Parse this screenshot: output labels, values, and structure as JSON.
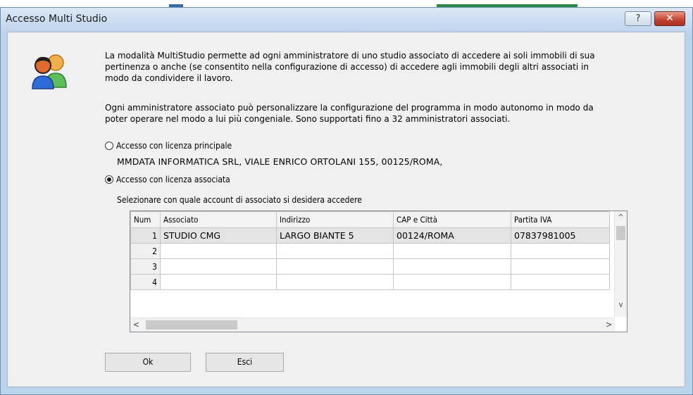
{
  "window": {
    "title": "Accesso Multi Studio",
    "help_button": "?",
    "close_button": "✕"
  },
  "icon": "users-icon",
  "description": {
    "paragraph1": "La modalità MultiStudio permette ad ogni amministratore di uno studio associato di accedere ai soli immobili di sua pertinenza o anche (se consentito nella configurazione di accesso) di accedere agli immobili degli altri associati in modo da condividere il lavoro.",
    "paragraph2": "Ogni amministratore associato può personalizzare la configurazione del programma in modo autonomo in modo da poter operare nel modo a lui più congeniale. Sono supportati fino a 32 amministratori associati."
  },
  "options": {
    "principal_label": "Accesso con licenza principale",
    "principal_checked": false,
    "principal_info": "MMDATA INFORMATICA SRL, VIALE ENRICO ORTOLANI 155, 00125/ROMA,",
    "associated_label": "Accesso con licenza associata",
    "associated_checked": true
  },
  "select_label": "Selezionare con quale account di associato si desidera accedere",
  "table": {
    "columns": [
      "Num",
      "Associato",
      "Indirizzo",
      "CAP e Città",
      "Partita IVA"
    ],
    "rows": [
      {
        "num": "1",
        "associato": "STUDIO CMG",
        "indirizzo": "LARGO BIANTE 5",
        "cap": "00124/ROMA",
        "piva": "07837981005"
      },
      {
        "num": "2",
        "associato": "",
        "indirizzo": "",
        "cap": "",
        "piva": ""
      },
      {
        "num": "3",
        "associato": "",
        "indirizzo": "",
        "cap": "",
        "piva": ""
      },
      {
        "num": "4",
        "associato": "",
        "indirizzo": "",
        "cap": "",
        "piva": ""
      }
    ]
  },
  "scroll": {
    "up": "^",
    "down": "v",
    "left": "<",
    "right": ">"
  },
  "buttons": {
    "ok": "Ok",
    "esci": "Esci"
  },
  "colors": {
    "title_bar": "#bfd4ec",
    "close_button": "#c2412d",
    "dialog_bg": "#f0f0f0"
  }
}
